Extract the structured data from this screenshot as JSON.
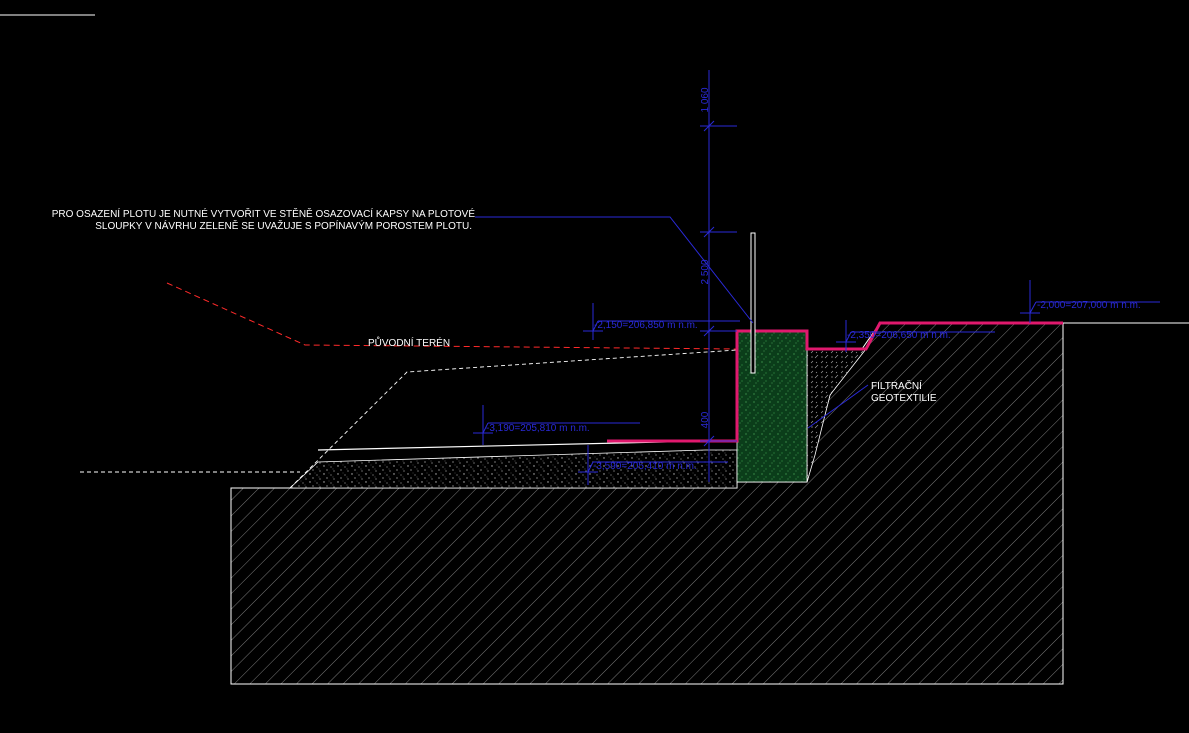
{
  "note": {
    "line1": "PRO OSAZENÍ PLOTU JE NUTNÉ VYTVOŘIT VE STĚNĚ OSAZOVACÍ KAPSY NA PLOTOVÉ",
    "line2": "SLOUPKY V NÁVRHU ZELENĚ SE UVAŽUJE S POPÍNAVÝM POROSTEM PLOTU."
  },
  "labels": {
    "original_terrain": "PŮVODNÍ  TERÉN",
    "geotextile_line1": "FILTRAČNÍ",
    "geotextile_line2": "GEOTEXTILIE"
  },
  "levels": {
    "top_right": "-2,000=207,000  m    n.m.",
    "wall_top": "-2,150=206,850  m   n.m.",
    "right_step": "-2,350=206,650  m    n.m.",
    "lower_left": "-3,190=205,810  m    n.m.",
    "bottom_left": "-3,590=205,410  m    n.m."
  },
  "dimensions": {
    "top": "1 060",
    "middle": "2 500",
    "bottom": "400"
  },
  "colors": {
    "background": "#000000",
    "lines": "#ffffff",
    "magenta": "#e0196e",
    "blue": "#2a2ad8",
    "red": "#ff2a2a",
    "wall_fill": "#0b3d1a"
  }
}
